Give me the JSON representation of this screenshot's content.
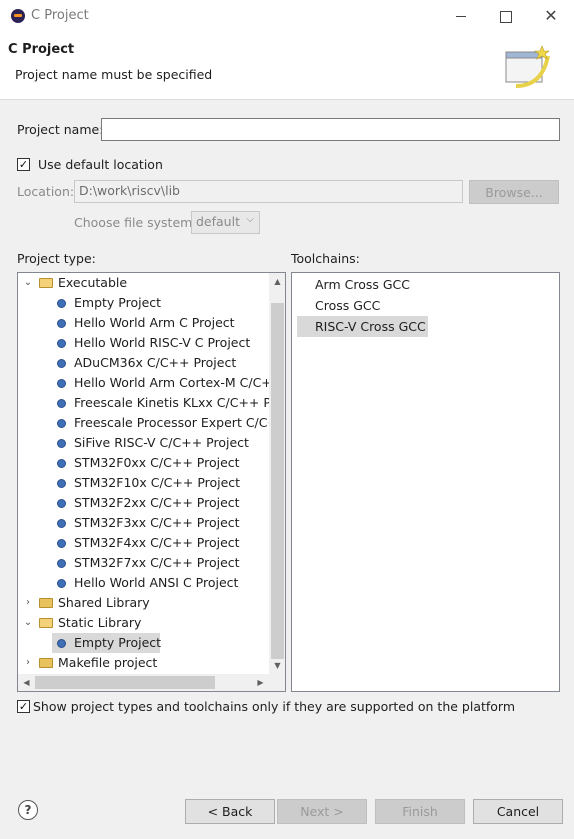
{
  "window": {
    "title": "C Project",
    "minimize_icon": "minimize-icon",
    "maximize_icon": "maximize-icon",
    "close_icon": "close-icon"
  },
  "header": {
    "title": "C Project",
    "message": "Project name must be specified"
  },
  "form": {
    "project_name_label": "Project name:",
    "project_name_value": "",
    "use_default_location_label": "Use default location",
    "use_default_location_checked": true,
    "location_label": "Location:",
    "location_value": "D:\\work\\riscv\\lib",
    "browse_label": "Browse...",
    "file_system_label": "Choose file system:",
    "file_system_value": "default"
  },
  "project_type": {
    "label": "Project type:",
    "tree": [
      {
        "label": "Executable",
        "kind": "folder",
        "expanded": true,
        "level": 0
      },
      {
        "label": "Empty Project",
        "kind": "item",
        "level": 1
      },
      {
        "label": "Hello World Arm C Project",
        "kind": "item",
        "level": 1
      },
      {
        "label": "Hello World RISC-V C Project",
        "kind": "item",
        "level": 1
      },
      {
        "label": "ADuCM36x C/C++ Project",
        "kind": "item",
        "level": 1
      },
      {
        "label": "Hello World Arm Cortex-M C/C++ P",
        "kind": "item",
        "level": 1
      },
      {
        "label": "Freescale Kinetis KLxx C/C++ Proj",
        "kind": "item",
        "level": 1
      },
      {
        "label": "Freescale Processor Expert C/C++ P",
        "kind": "item",
        "level": 1
      },
      {
        "label": "SiFive RISC-V C/C++ Project",
        "kind": "item",
        "level": 1
      },
      {
        "label": "STM32F0xx C/C++ Project",
        "kind": "item",
        "level": 1
      },
      {
        "label": "STM32F10x C/C++ Project",
        "kind": "item",
        "level": 1
      },
      {
        "label": "STM32F2xx C/C++ Project",
        "kind": "item",
        "level": 1
      },
      {
        "label": "STM32F3xx C/C++ Project",
        "kind": "item",
        "level": 1
      },
      {
        "label": "STM32F4xx C/C++ Project",
        "kind": "item",
        "level": 1
      },
      {
        "label": "STM32F7xx C/C++ Project",
        "kind": "item",
        "level": 1
      },
      {
        "label": "Hello World ANSI C Project",
        "kind": "item",
        "level": 1
      },
      {
        "label": "Shared Library",
        "kind": "folder",
        "expanded": false,
        "level": 0
      },
      {
        "label": "Static Library",
        "kind": "folder",
        "expanded": true,
        "level": 0
      },
      {
        "label": "Empty Project",
        "kind": "item",
        "level": 1,
        "selected": true
      },
      {
        "label": "Makefile project",
        "kind": "folder",
        "expanded": false,
        "level": 0
      }
    ]
  },
  "toolchains": {
    "label": "Toolchains:",
    "items": [
      {
        "label": "Arm Cross GCC"
      },
      {
        "label": "Cross GCC"
      },
      {
        "label": "RISC-V Cross GCC",
        "selected": true
      }
    ]
  },
  "filter": {
    "label": "Show project types and toolchains only if they are supported on the platform",
    "checked": true
  },
  "footer": {
    "back_label": "< Back",
    "next_label": "Next >",
    "finish_label": "Finish",
    "cancel_label": "Cancel",
    "help_icon": "help-icon"
  }
}
